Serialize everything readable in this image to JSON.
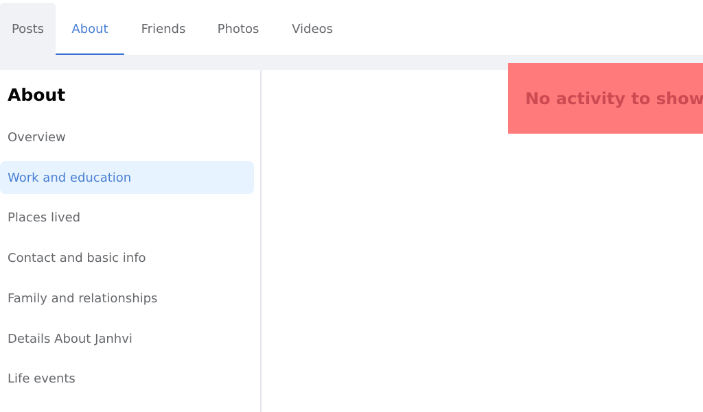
{
  "tabs": [
    {
      "label": "Posts",
      "state": "hover"
    },
    {
      "label": "About",
      "state": "active"
    },
    {
      "label": "Friends",
      "state": ""
    },
    {
      "label": "Photos",
      "state": ""
    },
    {
      "label": "Videos",
      "state": ""
    }
  ],
  "sidebar": {
    "title": "About",
    "items": [
      {
        "label": "Overview",
        "active": false
      },
      {
        "label": "Work and education",
        "active": true
      },
      {
        "label": "Places lived",
        "active": false
      },
      {
        "label": "Contact and basic info",
        "active": false
      },
      {
        "label": "Family and relationships",
        "active": false
      },
      {
        "label": "Details About Janhvi",
        "active": false
      },
      {
        "label": "Life events",
        "active": false
      }
    ]
  },
  "main": {
    "empty_message": "No activity to show"
  },
  "colors": {
    "accent": "#4a7fd4",
    "active_bg": "#e7f3ff",
    "empty_box_bg": "#ff7b7b",
    "empty_box_text": "#cc4a52"
  }
}
